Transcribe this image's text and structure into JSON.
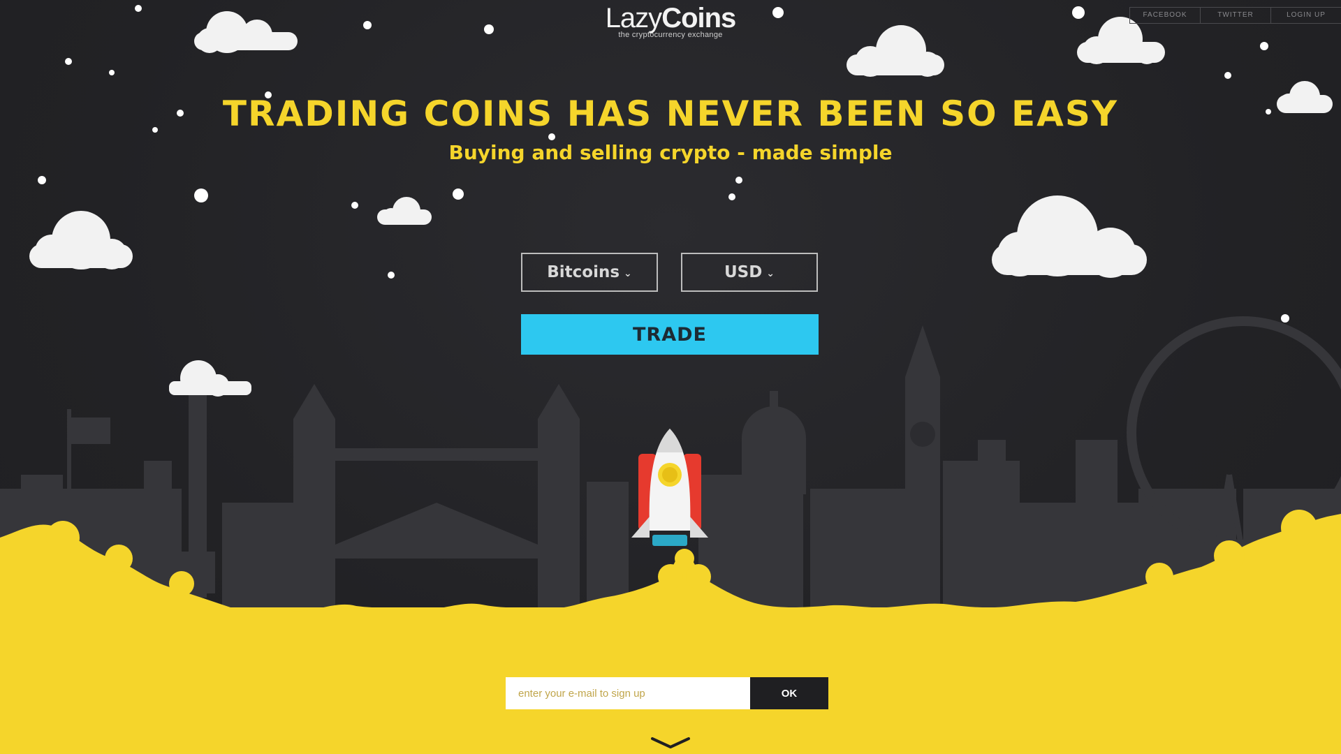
{
  "brand": {
    "name_light": "Lazy",
    "name_bold": "Coins",
    "tagline": "the cryptocurrency exchange"
  },
  "social": {
    "links": [
      "FACEBOOK",
      "TWITTER",
      "LOGIN UP"
    ]
  },
  "hero": {
    "title": "TRADING COINS HAS NEVER BEEN SO EASY",
    "subtitle": "Buying and selling crypto - made simple"
  },
  "trade_form": {
    "coin_select": "Bitcoins",
    "currency_select": "USD",
    "trade_label": "TRADE"
  },
  "signup": {
    "placeholder": "enter your e-mail to sign up",
    "submit_label": "OK"
  },
  "colors": {
    "background": "#232326",
    "accent_yellow": "#f5d52b",
    "trade_blue": "#2dc8f0",
    "cloud": "#f2f2f2",
    "skyline": "#36363a",
    "rocket_red": "#e63a2e"
  },
  "icons": [
    "chevron-down-icon",
    "rocket-icon",
    "cloud-icon",
    "star-icon",
    "scroll-down-icon"
  ]
}
